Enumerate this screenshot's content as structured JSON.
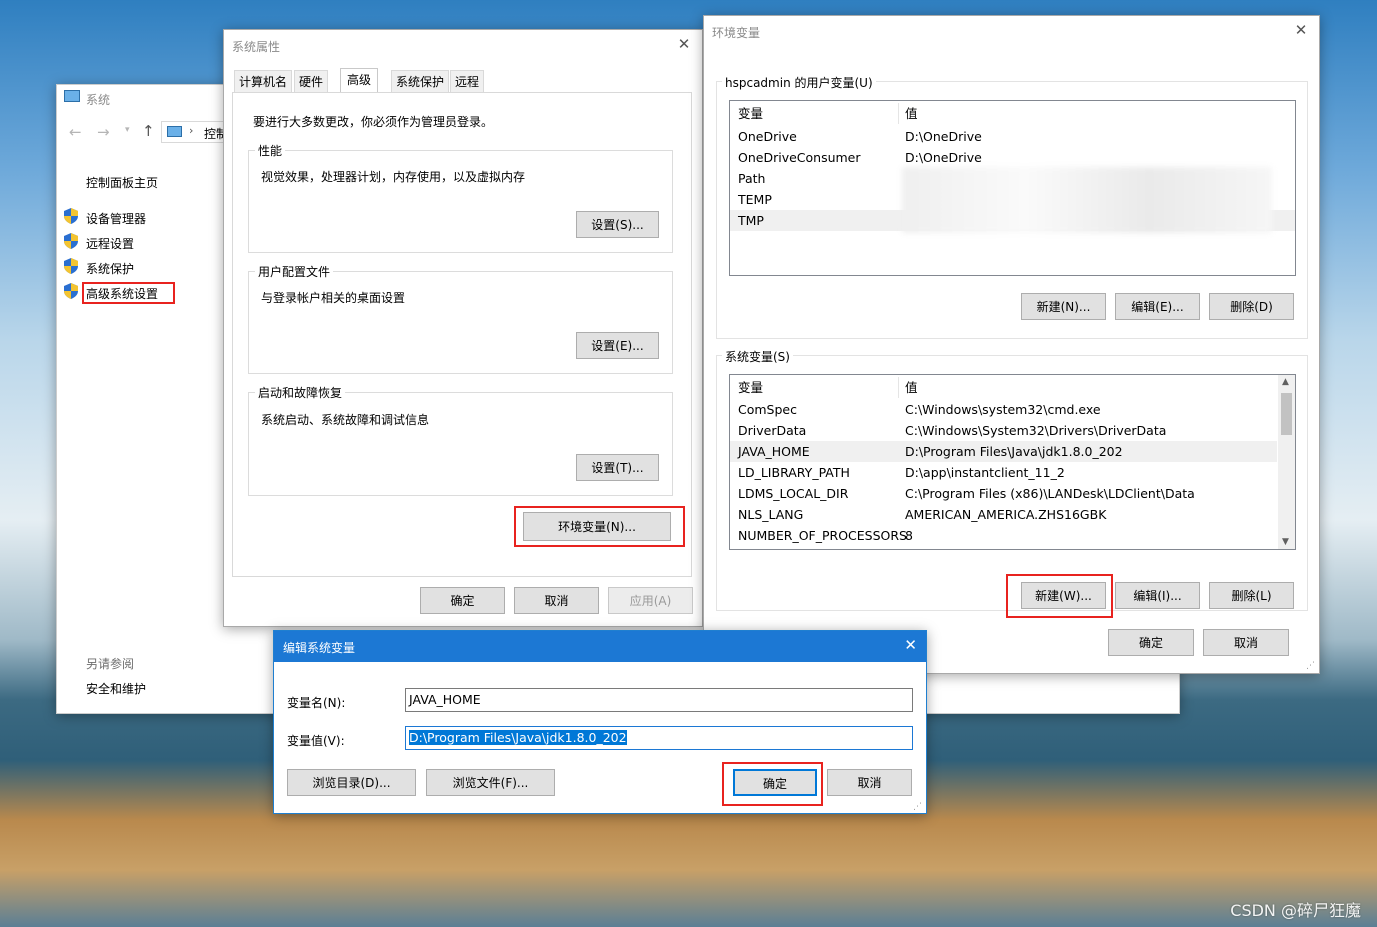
{
  "system_window": {
    "title": "系统",
    "breadcrumb": "控制",
    "nav_home": "控制面板主页",
    "links": [
      {
        "label": "设备管理器"
      },
      {
        "label": "远程设置"
      },
      {
        "label": "系统保护"
      },
      {
        "label": "高级系统设置"
      }
    ],
    "see_also": "另请参阅",
    "security_link": "安全和维护"
  },
  "props_window": {
    "title": "系统属性",
    "tabs": [
      "计算机名",
      "硬件",
      "高级",
      "系统保护",
      "远程"
    ],
    "admin_note": "要进行大多数更改，你必须作为管理员登录。",
    "performance": {
      "title": "性能",
      "desc": "视觉效果，处理器计划，内存使用，以及虚拟内存",
      "button": "设置(S)..."
    },
    "profiles": {
      "title": "用户配置文件",
      "desc": "与登录帐户相关的桌面设置",
      "button": "设置(E)..."
    },
    "startup": {
      "title": "启动和故障恢复",
      "desc": "系统启动、系统故障和调试信息",
      "button": "设置(T)..."
    },
    "env_button": "环境变量(N)...",
    "ok": "确定",
    "cancel": "取消",
    "apply": "应用(A)"
  },
  "env_window": {
    "title": "环境变量",
    "user_section": "hspcadmin 的用户变量(U)",
    "col_var": "变量",
    "col_val": "值",
    "user_vars": [
      {
        "name": "OneDrive",
        "value": "D:\\OneDrive"
      },
      {
        "name": "OneDriveConsumer",
        "value": "D:\\OneDrive"
      },
      {
        "name": "Path",
        "value": ""
      },
      {
        "name": "TEMP",
        "value": ""
      },
      {
        "name": "TMP",
        "value": ""
      }
    ],
    "user_buttons": {
      "new": "新建(N)...",
      "edit": "编辑(E)...",
      "delete": "删除(D)"
    },
    "sys_section": "系统变量(S)",
    "sys_vars": [
      {
        "name": "ComSpec",
        "value": "C:\\Windows\\system32\\cmd.exe"
      },
      {
        "name": "DriverData",
        "value": "C:\\Windows\\System32\\Drivers\\DriverData"
      },
      {
        "name": "JAVA_HOME",
        "value": "D:\\Program Files\\Java\\jdk1.8.0_202"
      },
      {
        "name": "LD_LIBRARY_PATH",
        "value": "D:\\app\\instantclient_11_2"
      },
      {
        "name": "LDMS_LOCAL_DIR",
        "value": "C:\\Program Files (x86)\\LANDesk\\LDClient\\Data"
      },
      {
        "name": "NLS_LANG",
        "value": "AMERICAN_AMERICA.ZHS16GBK"
      },
      {
        "name": "NUMBER_OF_PROCESSORS",
        "value": "8"
      }
    ],
    "sys_buttons": {
      "new": "新建(W)...",
      "edit": "编辑(I)...",
      "delete": "删除(L)"
    },
    "ok": "确定",
    "cancel": "取消"
  },
  "edit_dialog": {
    "title": "编辑系统变量",
    "name_label": "变量名(N):",
    "name_value": "JAVA_HOME",
    "value_label": "变量值(V):",
    "value_value": "D:\\Program Files\\Java\\jdk1.8.0_202",
    "browse_dir": "浏览目录(D)...",
    "browse_file": "浏览文件(F)...",
    "ok": "确定",
    "cancel": "取消"
  },
  "watermark": "CSDN @碎尸狂魔"
}
